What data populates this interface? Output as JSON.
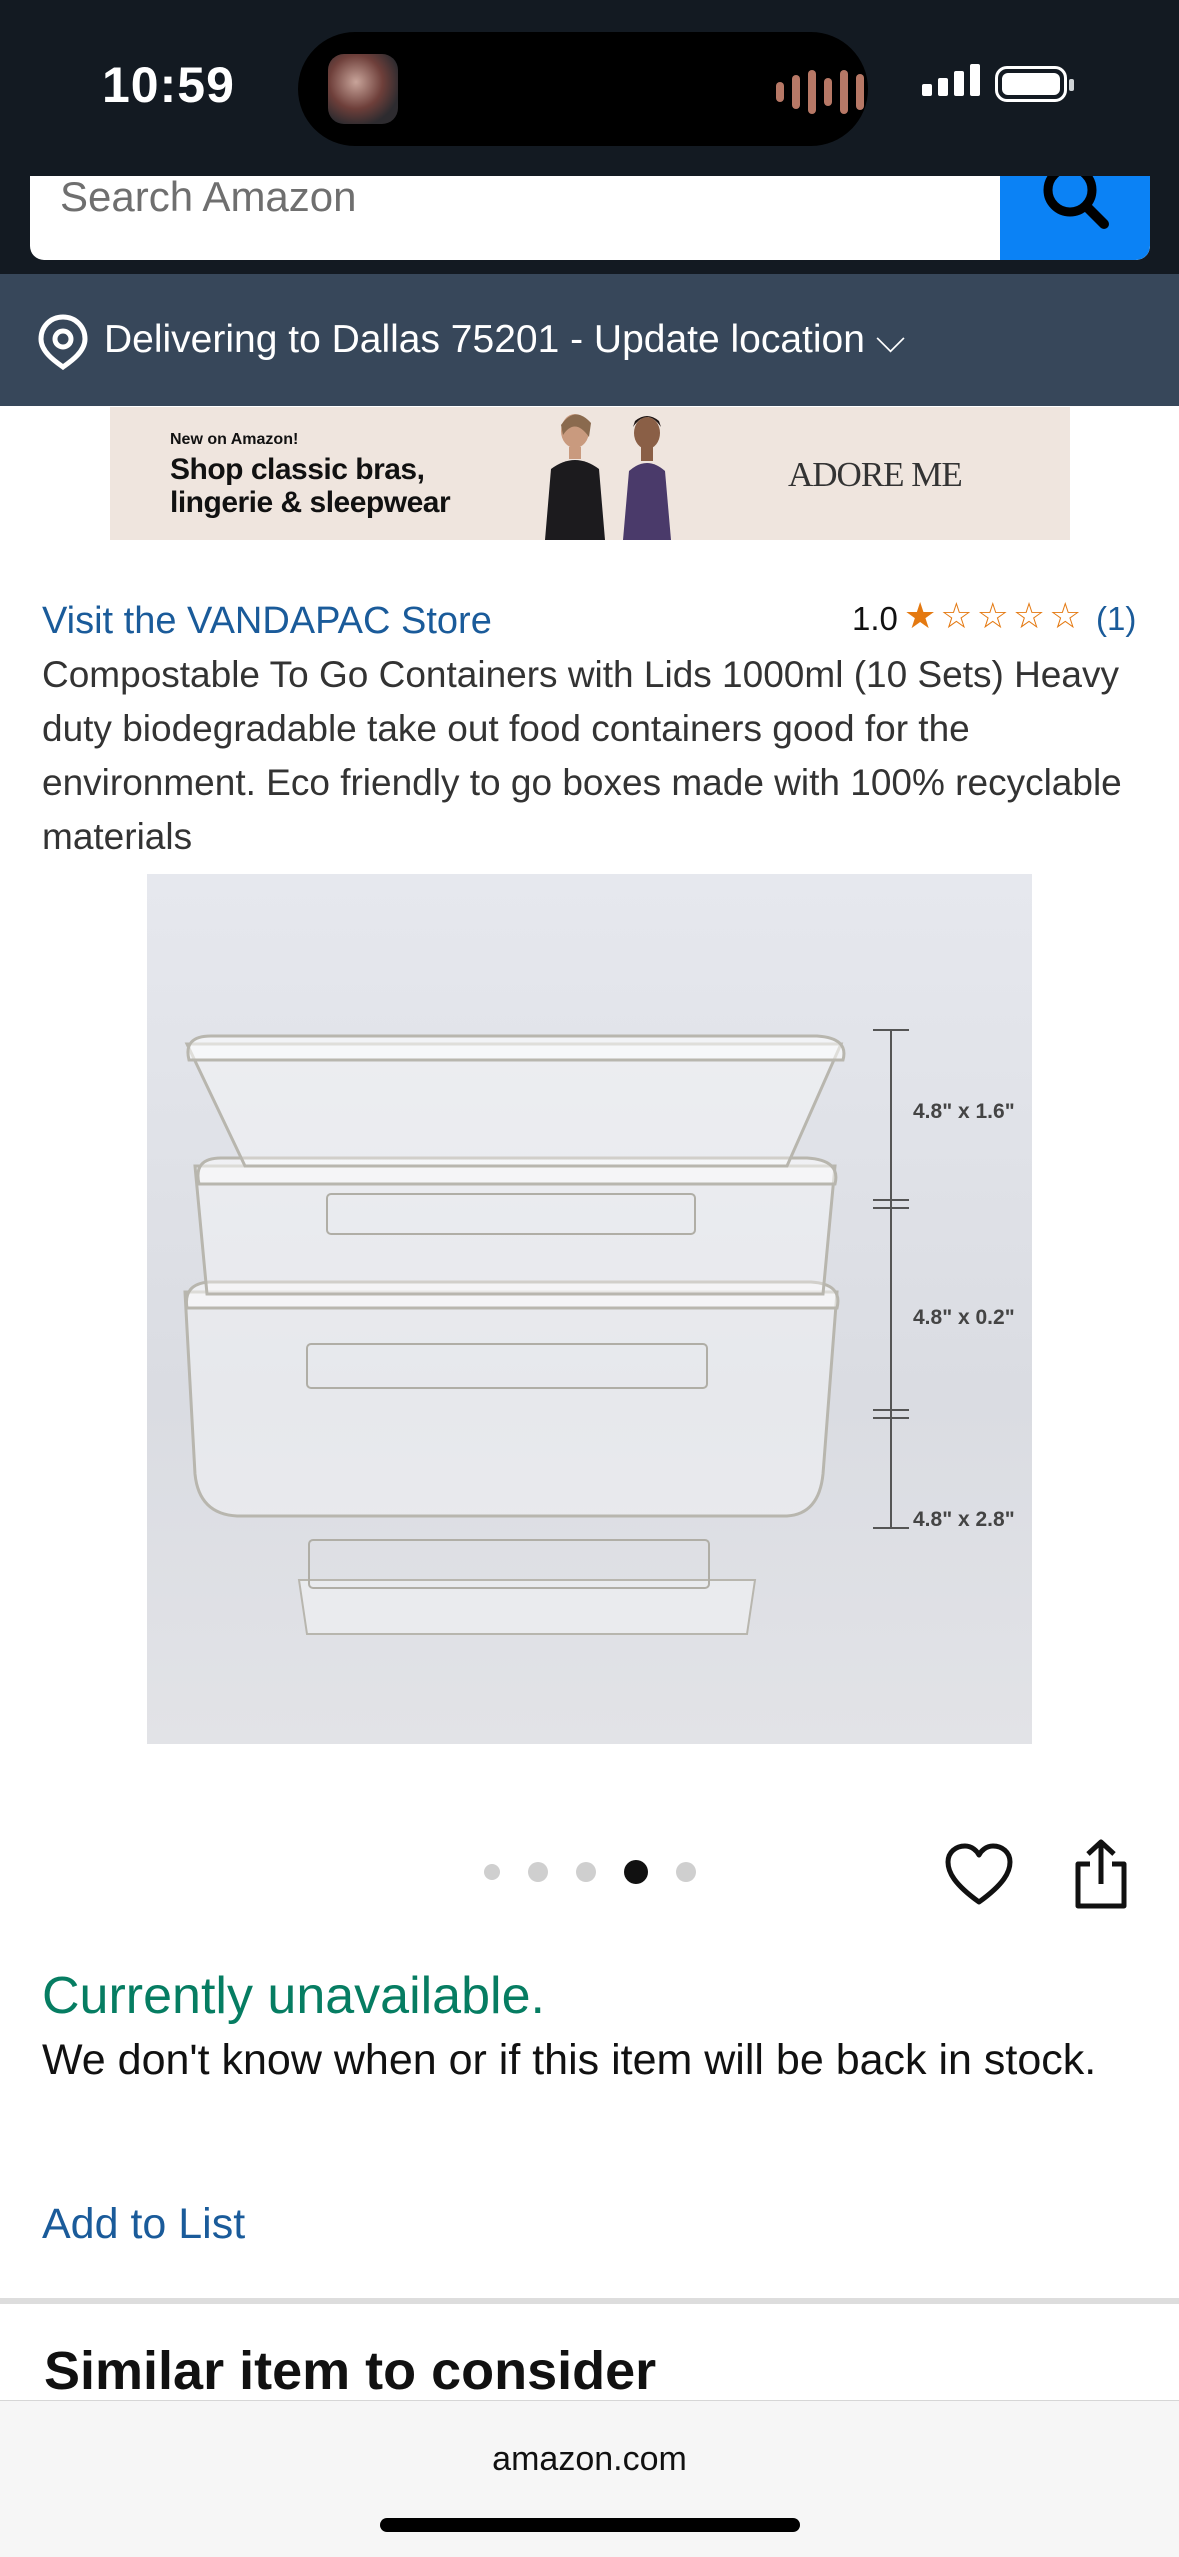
{
  "status_bar": {
    "time": "10:59"
  },
  "search": {
    "placeholder": "Search Amazon"
  },
  "delivery": {
    "text": "Delivering to Dallas 75201 - Update location ⌵"
  },
  "ad": {
    "tagline": "New on Amazon!",
    "headline_1": "Shop classic bras,",
    "headline_2": "lingerie & sleepwear",
    "brand": "ADORE ME"
  },
  "product": {
    "store_link": "Visit the VANDAPAC Store",
    "rating": "1.0",
    "rating_value": 1,
    "rating_max": 5,
    "review_count": "(1)",
    "title": "Compostable To Go Containers with Lids 1000ml (10 Sets) Heavy duty biodegradable take out food containers good for the environment. Eco friendly to go boxes made with 100% recyclable materials",
    "image_dimensions": [
      "4.8\" x 1.6\"",
      "4.8\" x 0.2\"",
      "4.8\" x 2.8\""
    ],
    "image_count": 5,
    "active_image_index": 3
  },
  "availability": {
    "status": "Currently unavailable.",
    "message": "We don't know when or if this item will be back in stock.",
    "add_to_list": "Add to List"
  },
  "similar": {
    "heading": "Similar item to consider"
  },
  "browser": {
    "url": "amazon.com"
  },
  "colors": {
    "header": "#131a22",
    "delivery_bar": "#37475a",
    "search_button": "#0b82f5",
    "link": "#1a5b9a",
    "star": "#e47911",
    "unavailable": "#067d62"
  },
  "icons": [
    "location-pin-icon",
    "search-icon",
    "heart-icon",
    "share-icon",
    "chevron-down-icon"
  ]
}
